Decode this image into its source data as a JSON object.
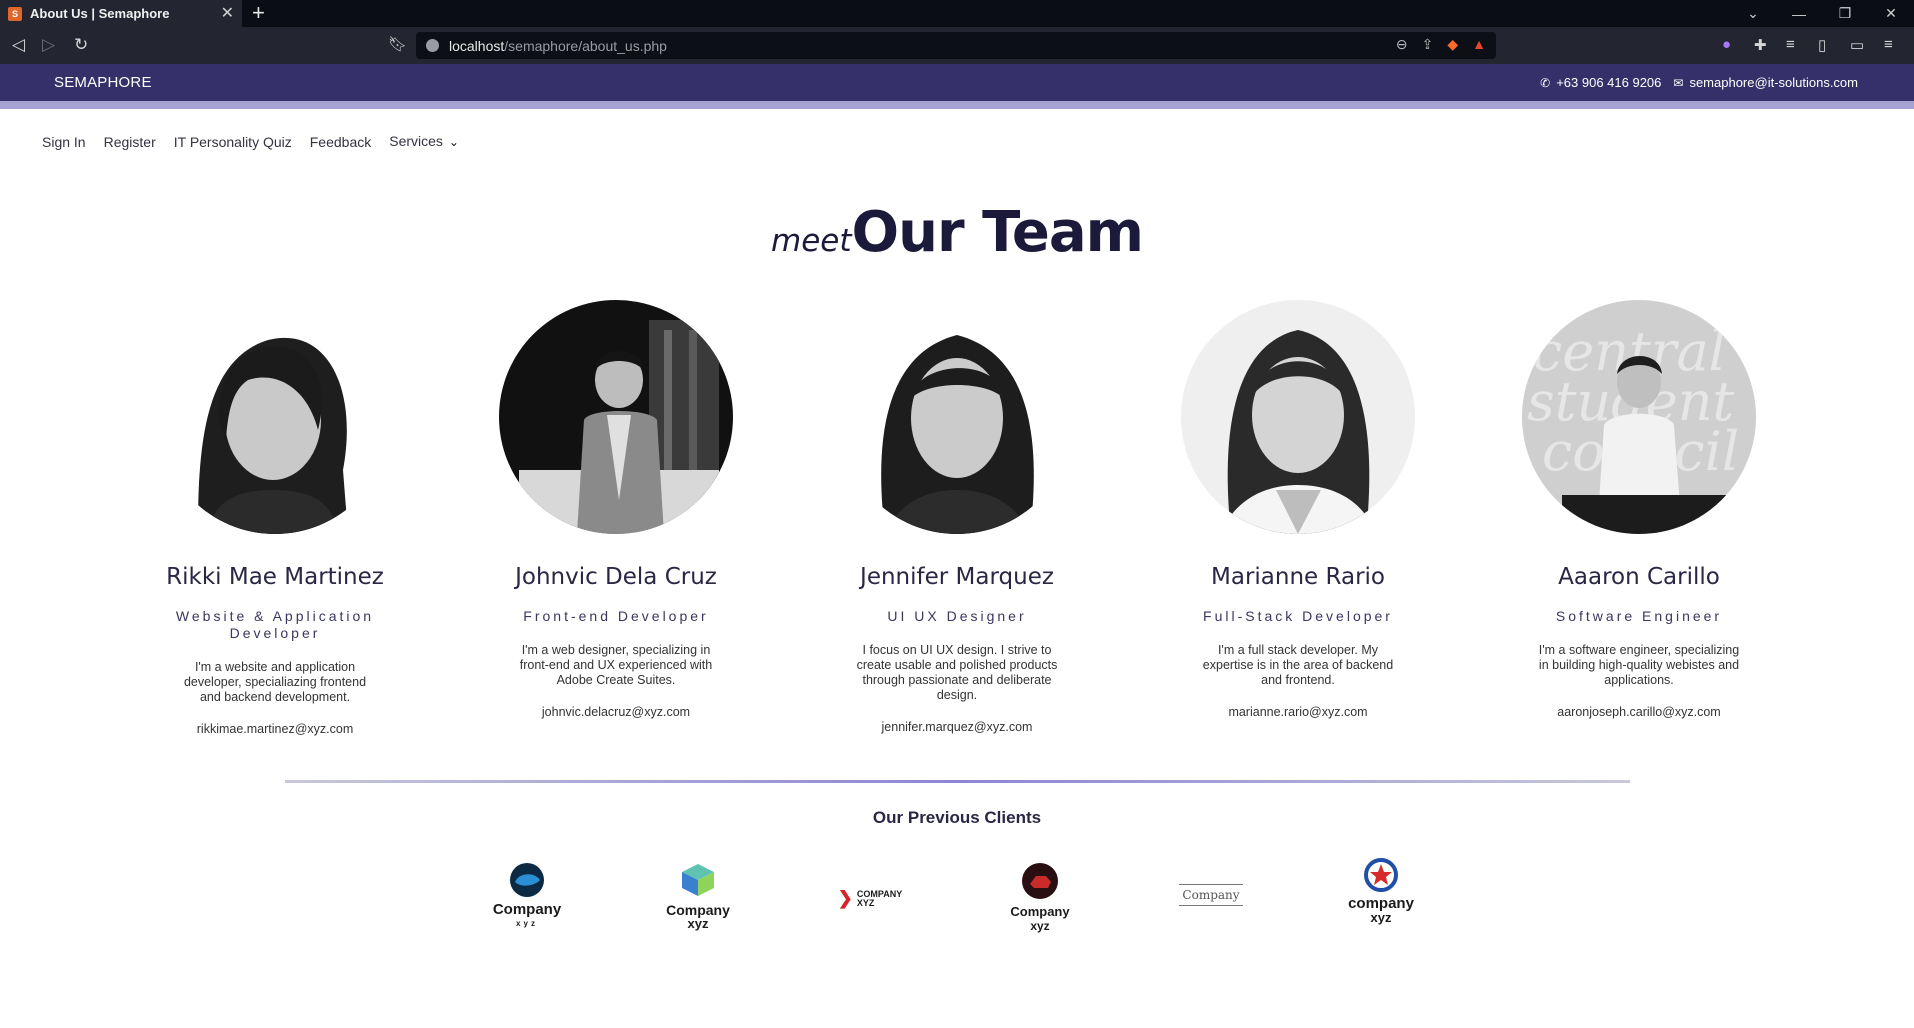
{
  "browser": {
    "tab_title": "About Us | Semaphore",
    "url_host": "localhost",
    "url_path": "/semaphore/about_us.php"
  },
  "site": {
    "brand": "SEMAPHORE",
    "phone": "+63 906 416 9206",
    "email": "semaphore@it-solutions.com",
    "nav": [
      "Sign In",
      "Register",
      "IT Personality Quiz",
      "Feedback",
      "Services"
    ]
  },
  "team": {
    "heading_small": "meet",
    "heading_large": "Our Team",
    "members": [
      {
        "name": "Rikki Mae Martinez",
        "role": "Website & Application Developer",
        "bio": "I'm a website and application developer, specialiazing frontend and backend development.",
        "email": "rikkimae.martinez@xyz.com"
      },
      {
        "name": "Johnvic Dela Cruz",
        "role": "Front-end Developer",
        "bio": "I'm a web designer, specializing in front-end and UX experienced with Adobe Create Suites.",
        "email": "johnvic.delacruz@xyz.com"
      },
      {
        "name": "Jennifer Marquez",
        "role": "UI UX Designer",
        "bio": "I focus on UI UX design. I strive to create usable and polished products through passionate and deliberate design.",
        "email": "jennifer.marquez@xyz.com"
      },
      {
        "name": "Marianne Rario",
        "role": "Full-Stack Developer",
        "bio": "I'm a full stack developer. My expertise is in the area of backend and frontend.",
        "email": "marianne.rario@xyz.com"
      },
      {
        "name": "Aaaron Carillo",
        "role": "Software Engineer",
        "bio": "I'm a software engineer, specializing in building high-quality webistes and applications.",
        "email": "aaronjoseph.carillo@xyz.com"
      }
    ]
  },
  "clients": {
    "title": "Our Previous Clients",
    "logos": [
      {
        "line1": "Company",
        "line2": "xyz"
      },
      {
        "line1": "Company",
        "line2": "xyz"
      },
      {
        "line1": "COMPANY",
        "line2": "XYZ"
      },
      {
        "line1": "Company",
        "line2": "xyz"
      },
      {
        "line1": "Company",
        "line2": ""
      },
      {
        "line1": "company",
        "line2": "xyz"
      }
    ]
  }
}
